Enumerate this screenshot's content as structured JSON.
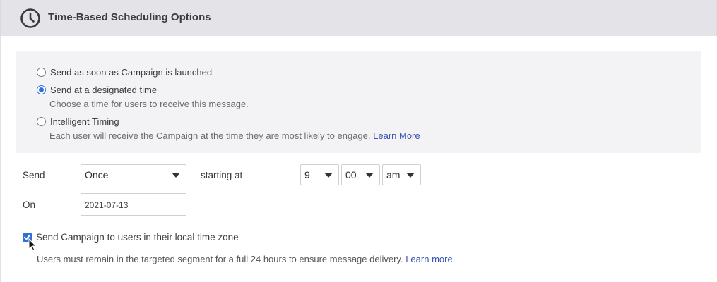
{
  "header": {
    "title": "Time-Based Scheduling Options",
    "icon": "clock-icon"
  },
  "delivery_options": [
    {
      "label": "Send as soon as Campaign is launched",
      "selected": false
    },
    {
      "label": "Send at a designated time",
      "selected": true,
      "description": "Choose a time for users to receive this message."
    },
    {
      "label": "Intelligent Timing",
      "selected": false,
      "description": "Each user will receive the Campaign at the time they are most likely to engage.",
      "link": "Learn More"
    }
  ],
  "schedule": {
    "send_label": "Send",
    "frequency": "Once",
    "starting_at_label": "starting at",
    "hour": "9",
    "minute": "00",
    "ampm": "am",
    "on_label": "On",
    "date": "2021-07-13"
  },
  "local_time": {
    "checked": true,
    "label": "Send Campaign to users in their local time zone",
    "note": "Users must remain in the targeted segment for a full 24 hours to ensure message delivery.",
    "link": "Learn more."
  },
  "colors": {
    "accent": "#2f6fdb",
    "link": "#3a52b4",
    "header_bg": "#e4e4e8",
    "panel_bg": "#f3f3f5"
  }
}
